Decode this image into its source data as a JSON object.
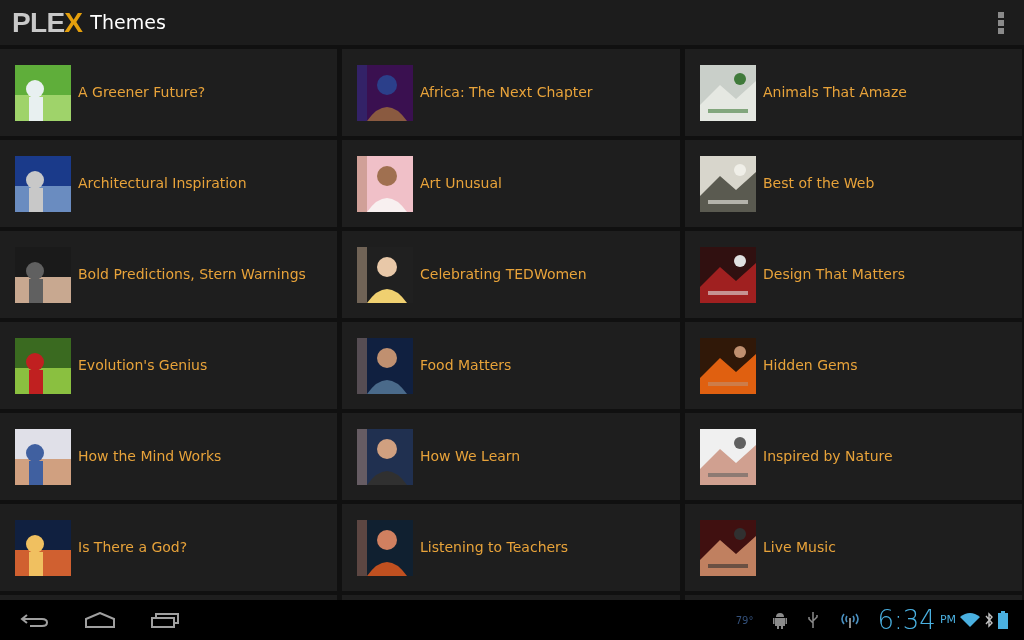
{
  "app_bar": {
    "logo": [
      {
        "text": "PLE",
        "accent": false
      },
      {
        "text": "X",
        "accent": true
      }
    ],
    "title": "Themes"
  },
  "themes": [
    {
      "title": "A Greener Future?"
    },
    {
      "title": "Africa: The Next Chapter"
    },
    {
      "title": "Animals That Amaze"
    },
    {
      "title": "Architectural Inspiration"
    },
    {
      "title": "Art Unusual"
    },
    {
      "title": "Best of the Web"
    },
    {
      "title": "Bold Predictions, Stern Warnings"
    },
    {
      "title": "Celebrating TEDWomen"
    },
    {
      "title": "Design That Matters"
    },
    {
      "title": "Evolution's Genius"
    },
    {
      "title": "Food Matters"
    },
    {
      "title": "Hidden Gems"
    },
    {
      "title": "How the Mind Works"
    },
    {
      "title": "How We Learn"
    },
    {
      "title": "Inspired by Nature"
    },
    {
      "title": "Is There a God?"
    },
    {
      "title": "Listening to Teachers"
    },
    {
      "title": "Live Music"
    }
  ],
  "status_bar": {
    "temperature": "79°",
    "time": "6:34",
    "meridiem": "PM"
  }
}
